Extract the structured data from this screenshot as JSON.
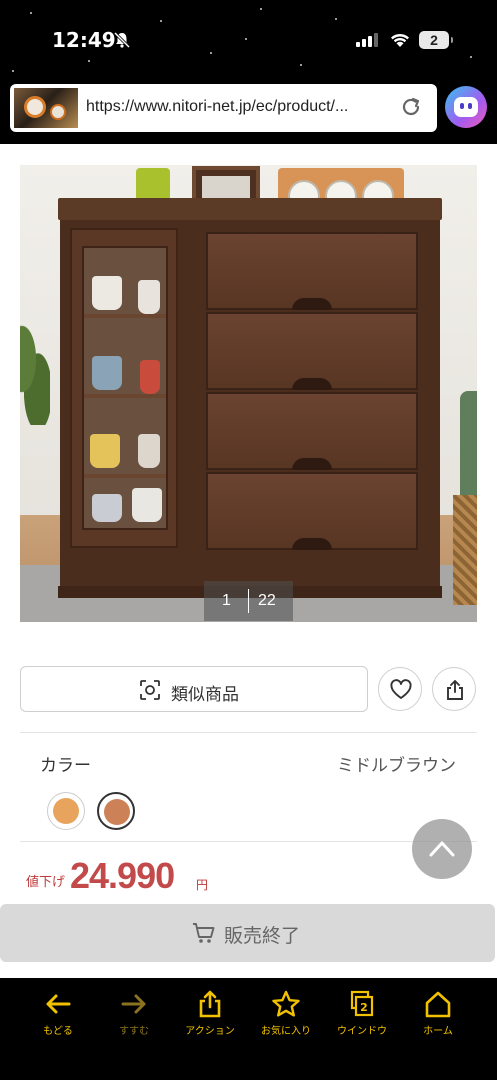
{
  "status_bar": {
    "time": "12:49",
    "battery": "2"
  },
  "browser": {
    "url": "https://www.nitori-net.jp/ec/product/...",
    "tab_count": "2"
  },
  "product": {
    "pager": {
      "current": "1",
      "total": "22"
    },
    "similar_label": "類似商品",
    "color_label": "カラー",
    "color_value": "ミドルブラウン",
    "swatches": [
      {
        "color": "#e8a35c",
        "selected": false
      },
      {
        "color": "#cc8256",
        "selected": true
      }
    ],
    "price_prefix": "値下げ",
    "price": "24.990",
    "price_unit": "円",
    "soldout_label": "販売終了"
  },
  "toolbar": {
    "items": [
      {
        "label": "もどる",
        "icon": "back-arrow-icon"
      },
      {
        "label": "すすむ",
        "icon": "forward-arrow-icon"
      },
      {
        "label": "アクション",
        "icon": "share-action-icon"
      },
      {
        "label": "お気に入り",
        "icon": "star-icon"
      },
      {
        "label": "ウインドウ",
        "icon": "windows-icon"
      },
      {
        "label": "ホーム",
        "icon": "home-icon"
      }
    ]
  }
}
